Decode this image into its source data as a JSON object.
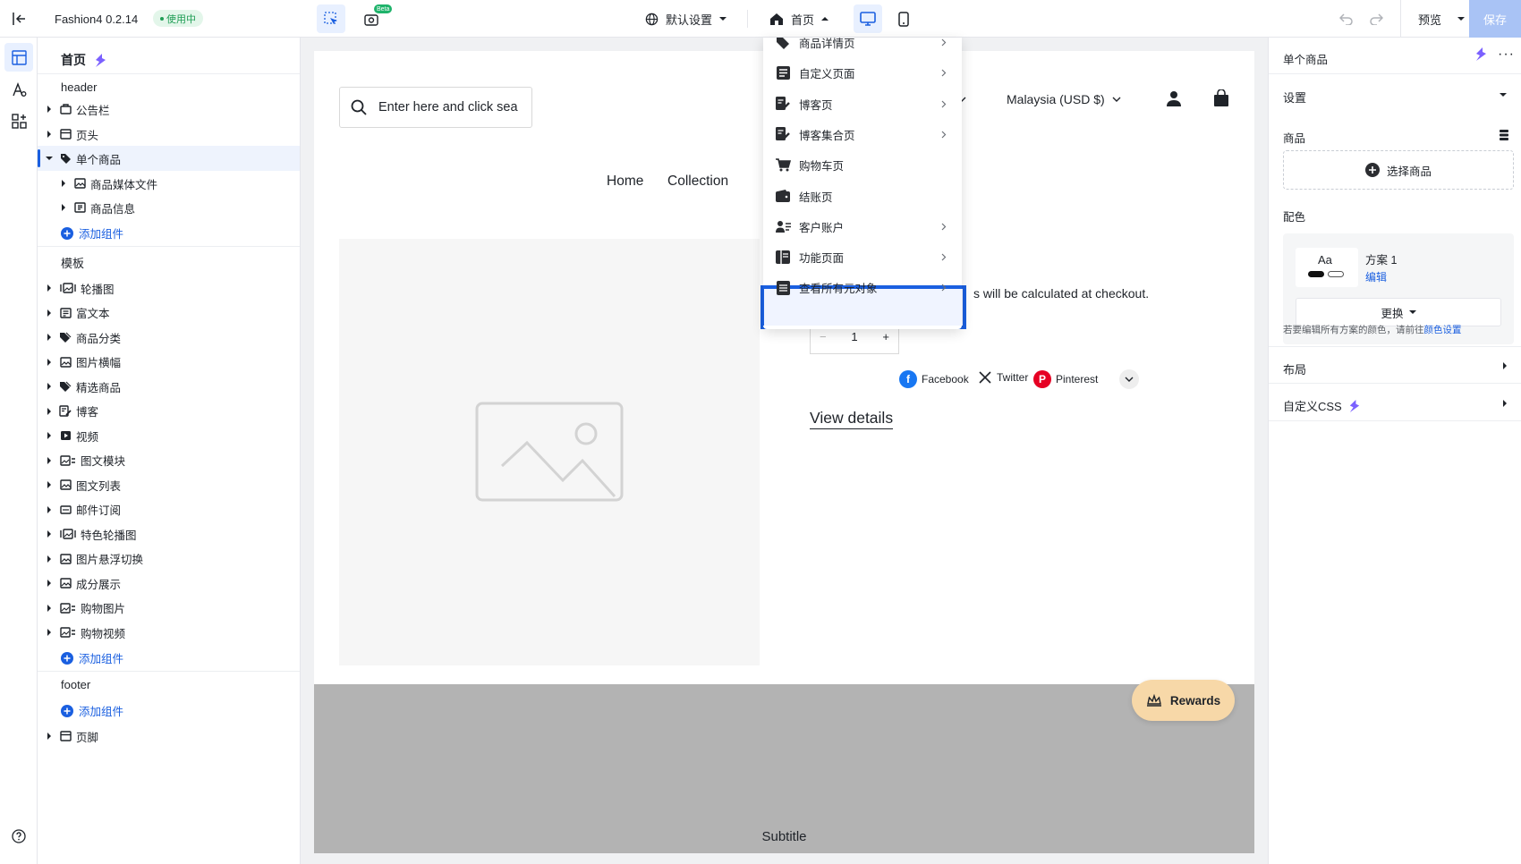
{
  "topbar": {
    "app_name": "Fashion4 0.2.14",
    "status_badge": "使用中",
    "beta_badge": "Beta",
    "settings_label": "默认设置",
    "page_label": "首页",
    "preview_label": "预览",
    "save_label": "保存"
  },
  "left_panel": {
    "title": "首页",
    "header_section": "header",
    "header_items": [
      "公告栏",
      "页头",
      "单个商品"
    ],
    "sub_items": [
      "商品媒体文件",
      "商品信息"
    ],
    "add_component": "添加组件",
    "template_section": "模板",
    "template_items": [
      "轮播图",
      "富文本",
      "商品分类",
      "图片横幅",
      "精选商品",
      "博客",
      "视频",
      "图文模块",
      "图文列表",
      "邮件订阅",
      "特色轮播图",
      "图片悬浮切换",
      "成分展示",
      "购物图片",
      "购物视频"
    ],
    "footer_section": "footer",
    "footer_items": [
      "页脚"
    ]
  },
  "canvas": {
    "search_placeholder": "Enter here and click sea",
    "nav_links": [
      "Home",
      "Collection"
    ],
    "language_partial": "sh",
    "currency": "Malaysia (USD $)",
    "tax_text_partial": "s will be calculated at checkout.",
    "quantity": "1",
    "qty_minus": "−",
    "qty_plus": "+",
    "share": [
      "Facebook",
      "Twitter",
      "Pinterest"
    ],
    "view_details": "View details",
    "rewards": "Rewards",
    "subtitle": "Subtitle"
  },
  "dropdown": {
    "items": [
      "商品详情页",
      "自定义页面",
      "博客页",
      "博客集合页",
      "购物车页",
      "结账页",
      "客户账户",
      "功能页面",
      "查看所有元对象"
    ]
  },
  "right_panel": {
    "title": "单个商品",
    "settings": "设置",
    "product_label": "商品",
    "choose_product": "选择商品",
    "color_label": "配色",
    "scheme_preview_text": "Aa",
    "scheme_name": "方案 1",
    "edit_link": "编辑",
    "change_btn": "更换",
    "hint_text": "若要编辑所有方案的颜色，请前往",
    "hint_link": "颜色设置",
    "layout": "布局",
    "custom_css": "自定义CSS"
  },
  "colors": {
    "accent": "#1a5fe0",
    "save_button": "#a9c3f5",
    "status_badge_bg": "#e3f6ea",
    "status_badge_text": "#1f9d55",
    "rewards_bg": "#f7d8a8",
    "footer_band": "#b3b3b3"
  }
}
